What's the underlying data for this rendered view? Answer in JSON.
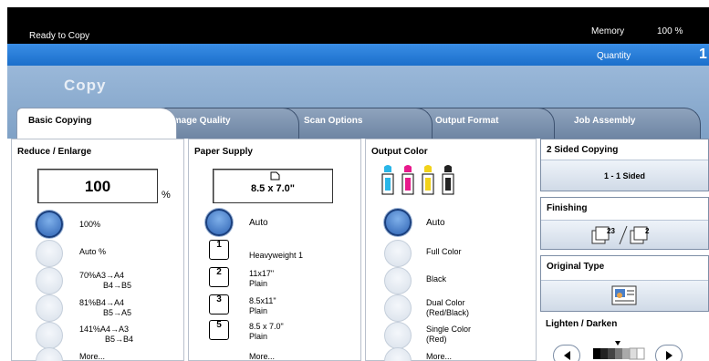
{
  "status": {
    "ready_text": "Ready to Copy",
    "memory_label": "Memory",
    "memory_value": "100 %"
  },
  "quantity": {
    "label": "Quantity",
    "value": "1"
  },
  "app": {
    "title": "Copy"
  },
  "tabs": [
    {
      "label": "Basic Copying"
    },
    {
      "label": "Image Quality"
    },
    {
      "label": "Scan Options"
    },
    {
      "label": "Output Format"
    },
    {
      "label": "Job Assembly"
    }
  ],
  "reduce_enlarge": {
    "title": "Reduce / Enlarge",
    "value": "100",
    "unit": "%",
    "options": [
      {
        "line1": "100%",
        "line2": ""
      },
      {
        "line1": "Auto %",
        "line2": ""
      },
      {
        "line1": "70%A3→A4",
        "line2": "B4→B5"
      },
      {
        "line1": "81%B4→A4",
        "line2": "B5→A5"
      },
      {
        "line1": "141%A4→A3",
        "line2": "B5→B4"
      },
      {
        "line1": "More...",
        "line2": ""
      }
    ]
  },
  "paper_supply": {
    "title": "Paper Supply",
    "value": "8.5 x 7.0\"",
    "options": [
      {
        "tray": "",
        "line1": "Auto",
        "line2": ""
      },
      {
        "tray": "1",
        "line1": "Heavyweight 1",
        "line2": ""
      },
      {
        "tray": "2",
        "line1": "11x17\"",
        "line2": "Plain"
      },
      {
        "tray": "3",
        "line1": "8.5x11\"",
        "line2": "Plain"
      },
      {
        "tray": "5",
        "line1": "8.5 x 7.0\"",
        "line2": "Plain"
      },
      {
        "tray": "",
        "line1": "More...",
        "line2": ""
      }
    ]
  },
  "output_color": {
    "title": "Output Color",
    "toner_colors": [
      "#29b6e8",
      "#e8198c",
      "#f2d21a",
      "#222222"
    ],
    "options": [
      {
        "line1": "Auto",
        "line2": ""
      },
      {
        "line1": "Full Color",
        "line2": ""
      },
      {
        "line1": "Black",
        "line2": ""
      },
      {
        "line1": "Dual Color",
        "line2": "(Red/Black)"
      },
      {
        "line1": "Single Color",
        "line2": "(Red)"
      },
      {
        "line1": "More...",
        "line2": ""
      }
    ]
  },
  "two_sided": {
    "title": "2 Sided Copying",
    "value": "1 - 1 Sided"
  },
  "finishing": {
    "title": "Finishing"
  },
  "original_type": {
    "title": "Original Type"
  },
  "lighten_darken": {
    "title": "Lighten / Darken"
  },
  "colors": {
    "bluebar": "#1b6fcb",
    "selected_radio": "#2f64b4"
  }
}
